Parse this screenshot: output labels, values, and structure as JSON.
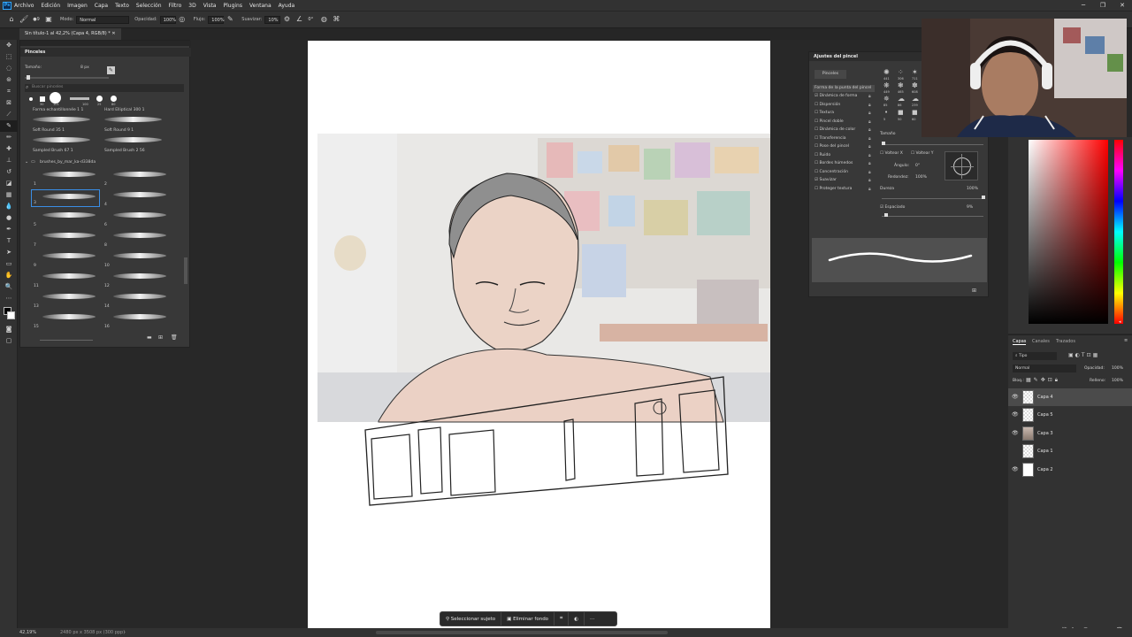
{
  "menubar": {
    "items": [
      "Archivo",
      "Edición",
      "Imagen",
      "Capa",
      "Texto",
      "Selección",
      "Filtro",
      "3D",
      "Vista",
      "Plugins",
      "Ventana",
      "Ayuda"
    ]
  },
  "options": {
    "modo_label": "Modo:",
    "modo_value": "Normal",
    "opacidad_label": "Opacidad:",
    "opacidad_value": "100%",
    "flujo_label": "Flujo:",
    "flujo_value": "100%",
    "suavizar_label": "Suavizar:",
    "suavizar_value": "10%",
    "angle_value": "0°",
    "brush_size": "9"
  },
  "doc": {
    "tab_title": "Sin título-1 al 42,2% (Capa 4, RGB/8) *"
  },
  "brushes": {
    "title": "Pinceles",
    "size_label": "Tamaño:",
    "size_value": "8 px",
    "search_placeholder": "Buscar pinceles",
    "preset_sizes": [
      "30",
      "101",
      "100",
      "25",
      "80"
    ],
    "named": [
      "Forma echantillonnée 1 1",
      "Hard Elliptical 300 1",
      "Soft Round 35 1",
      "Soft Round 9 1",
      "Sampled Brush 67 1",
      "Sampled Brush 2 56"
    ],
    "folder": "brushes_by_mar_ka-d338da",
    "numbered": [
      "1",
      "2",
      "3",
      "4",
      "5",
      "6",
      "7",
      "8",
      "9",
      "10",
      "11",
      "12",
      "13",
      "14",
      "15",
      "16"
    ]
  },
  "brush_settings": {
    "title": "Ajustes del pincel",
    "tab": "Pinceles",
    "options": [
      "Forma de la punta del pincel",
      "Dinámica de forma",
      "Dispersión",
      "Textura",
      "Pincel doble",
      "Dinámica de color",
      "Transferencia",
      "Pose del pincel",
      "Ruido",
      "Bordes húmedos",
      "Concentración",
      "Suavizar",
      "Proteger textura"
    ],
    "checked": [
      false,
      true,
      false,
      false,
      false,
      false,
      false,
      false,
      false,
      false,
      false,
      true,
      false
    ],
    "tip_numbers": [
      "441",
      "306",
      "711",
      "449",
      "465",
      "608",
      "85",
      "86",
      "239",
      "5",
      "50",
      "60"
    ],
    "tamano_label": "Tamaño",
    "voltear_x": "Voltear X",
    "voltear_y": "Voltear Y",
    "angulo_label": "Ángulo:",
    "angulo_value": "0°",
    "redondez_label": "Redondez:",
    "redondez_value": "100%",
    "dureza_label": "Dureza",
    "dureza_value": "100%",
    "espaciado_label": "Espaciado",
    "espaciado_value": "9%"
  },
  "layers": {
    "tabs": [
      "Capas",
      "Canales",
      "Trazados"
    ],
    "kind_label": "Tipo",
    "blend_mode": "Normal",
    "opacity_label": "Opacidad:",
    "opacity_value": "100%",
    "lock_label": "Bloq.:",
    "fill_label": "Relleno:",
    "fill_value": "100%",
    "rows": [
      {
        "name": "Capa 4",
        "visible": true,
        "selected": true
      },
      {
        "name": "Capa 5",
        "visible": true,
        "selected": false
      },
      {
        "name": "Capa 3",
        "visible": true,
        "selected": false
      },
      {
        "name": "Capa 1",
        "visible": false,
        "selected": false
      },
      {
        "name": "Capa 2",
        "visible": true,
        "selected": false
      }
    ]
  },
  "status": {
    "zoom": "42,19%",
    "doc_info": "2480 px x 3508 px (300 ppp)"
  },
  "taskbar": {
    "select_subject": "Seleccionar sujeto",
    "remove_bg": "Eliminar fondo"
  },
  "colors": {
    "accent": "#31a8ff",
    "selection": "#3a8ee6",
    "panel": "#383838",
    "hue_red": "#ff0000"
  }
}
